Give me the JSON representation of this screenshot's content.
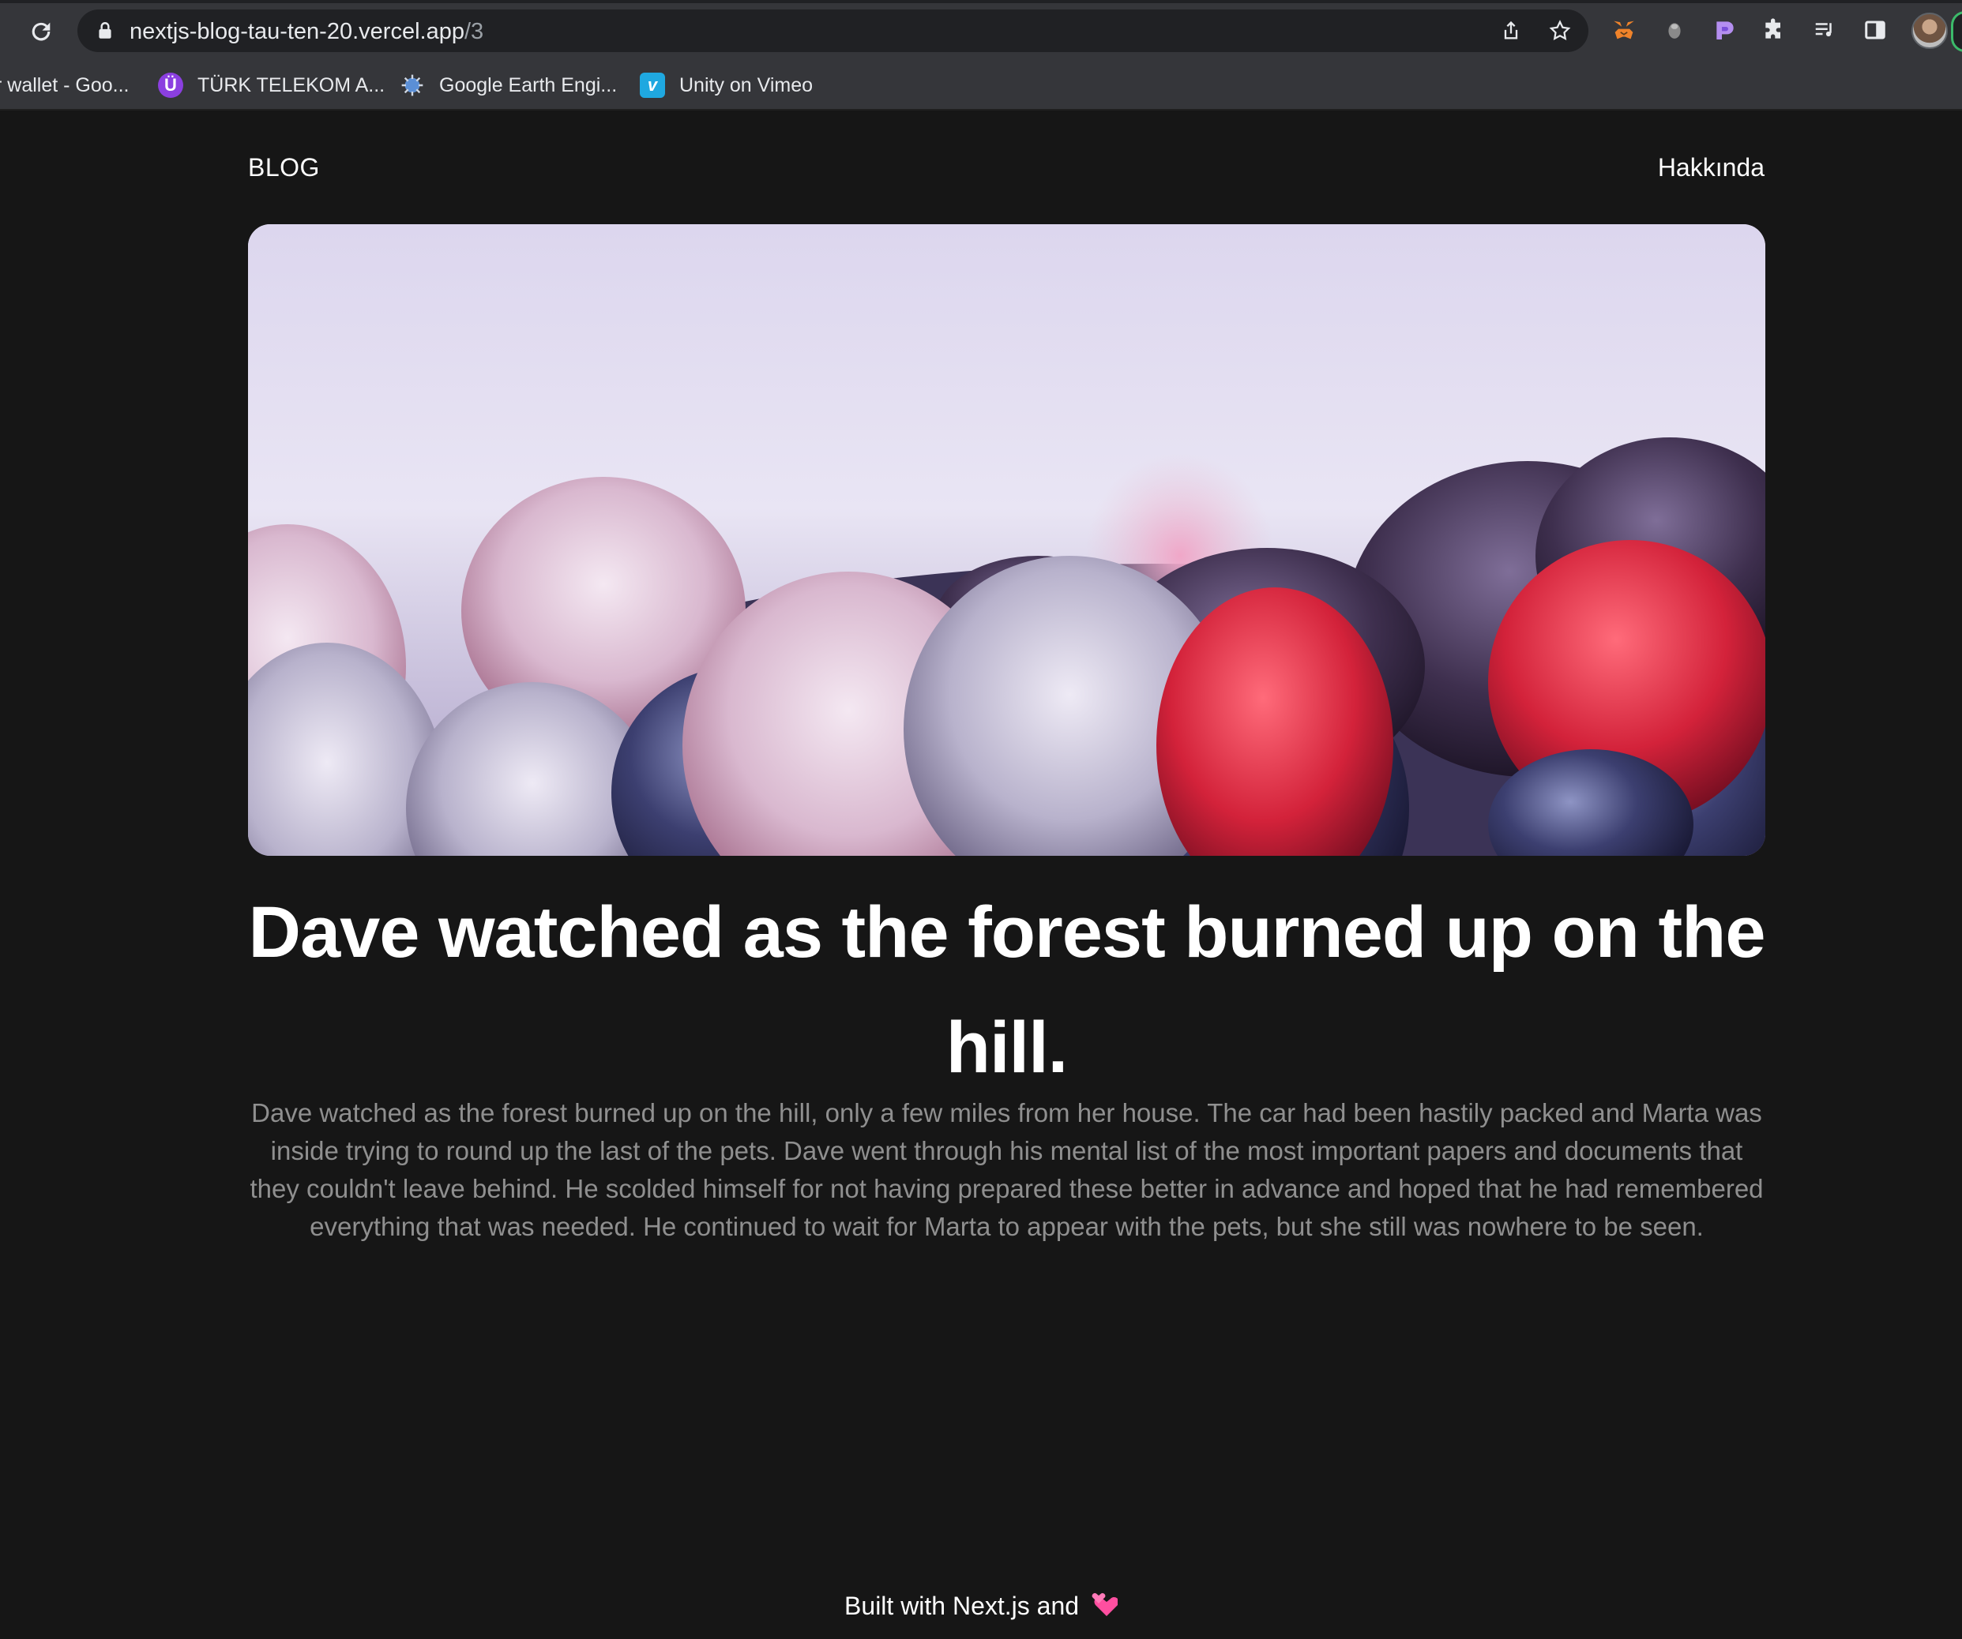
{
  "browser": {
    "url_host": "nextjs-blog-tau-ten-20.vercel.app",
    "url_path": "/3",
    "bookmarks": [
      {
        "label": "r wallet - Goo...",
        "icon": "google-wallet-icon"
      },
      {
        "label": "TÜRK TELEKOM A...",
        "icon": "turk-telekom-icon"
      },
      {
        "label": "Google Earth Engi...",
        "icon": "google-earth-engine-icon"
      },
      {
        "label": "Unity on Vimeo",
        "icon": "vimeo-icon"
      }
    ],
    "toolbar_icons": [
      "reload-icon",
      "lock-icon",
      "share-icon",
      "star-icon",
      "metamask-icon",
      "extension-icon",
      "extension-icon",
      "puzzle-icon",
      "media-icon",
      "side-panel-icon",
      "profile-avatar"
    ]
  },
  "nav": {
    "brand": "BLOG",
    "about": "Hakkında"
  },
  "post": {
    "title": "Dave watched as the forest burned up on the hill.",
    "body": "Dave watched as the forest burned up on the hill, only a few miles from her house. The car had been hastily packed and Marta was inside trying to round up the last of the pets. Dave went through his mental list of the most important papers and documents that they couldn't leave behind. He scolded himself for not having prepared these better in advance and hoped that he had remembered everything that was needed. He continued to wait for Marta to appear with the pets, but she still was nowhere to be seen.",
    "hero_alt": "Frozen berries"
  },
  "footer": {
    "text": "Built with Next.js and"
  }
}
